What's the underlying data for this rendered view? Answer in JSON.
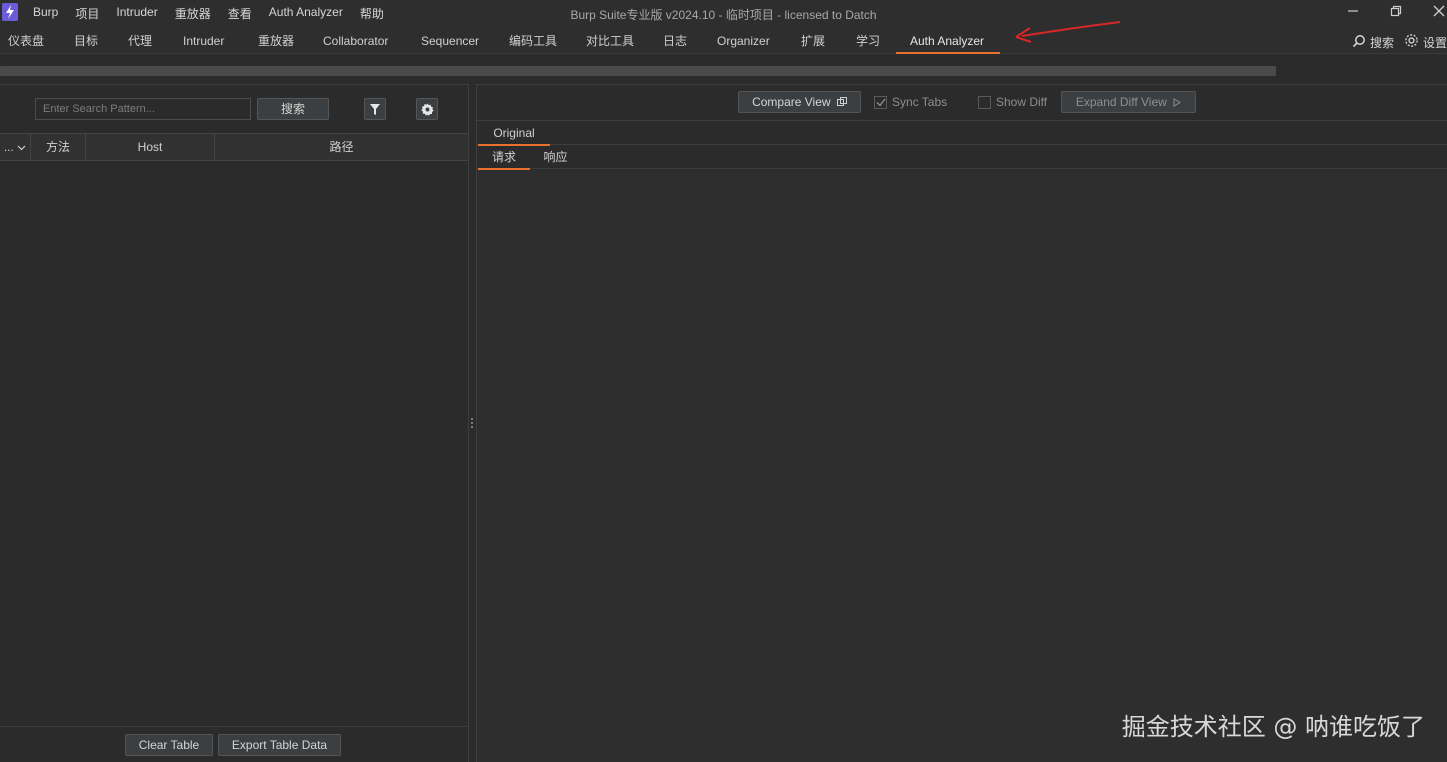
{
  "app": {
    "window_title": "Burp Suite专业版  v2024.10 - 临时项目 - licensed to Datch",
    "menu": [
      "Burp",
      "项目",
      "Intruder",
      "重放器",
      "查看",
      "Auth Analyzer",
      "帮助"
    ]
  },
  "tabs": [
    {
      "label": "仪表盘"
    },
    {
      "label": "目标"
    },
    {
      "label": "代理"
    },
    {
      "label": "Intruder"
    },
    {
      "label": "重放器"
    },
    {
      "label": "Collaborator"
    },
    {
      "label": "Sequencer"
    },
    {
      "label": "编码工具"
    },
    {
      "label": "对比工具"
    },
    {
      "label": "日志"
    },
    {
      "label": "Organizer"
    },
    {
      "label": "扩展"
    },
    {
      "label": "学习"
    },
    {
      "label": "Auth Analyzer",
      "active": true
    }
  ],
  "top_right": {
    "search_label": "搜索",
    "settings_label": "设置"
  },
  "left_panel": {
    "search_placeholder": "Enter Search Pattern...",
    "search_button": "搜索",
    "filter_icon": "filter-icon",
    "settings_icon": "gear-icon",
    "columns": [
      "...",
      "方法",
      "Host",
      "路径"
    ],
    "rows": [],
    "clear_table": "Clear Table",
    "export_table": "Export Table Data"
  },
  "right_panel": {
    "compare_view": "Compare View",
    "sync_tabs": {
      "label": "Sync Tabs",
      "checked": true,
      "enabled": false
    },
    "show_diff": {
      "label": "Show Diff",
      "checked": false,
      "enabled": false
    },
    "expand_diff_view": "Expand Diff View",
    "session_tabs": [
      {
        "label": "Original",
        "active": true
      }
    ],
    "message_tabs": [
      {
        "label": "请求",
        "active": true
      },
      {
        "label": "响应"
      }
    ]
  },
  "watermark": "掘金技术社区 @ 呐谁吃饭了",
  "colors": {
    "accent": "#e8712e",
    "background": "#2b2b2b",
    "logo": "#6b5bd6",
    "annotation_arrow": "#d62828"
  }
}
